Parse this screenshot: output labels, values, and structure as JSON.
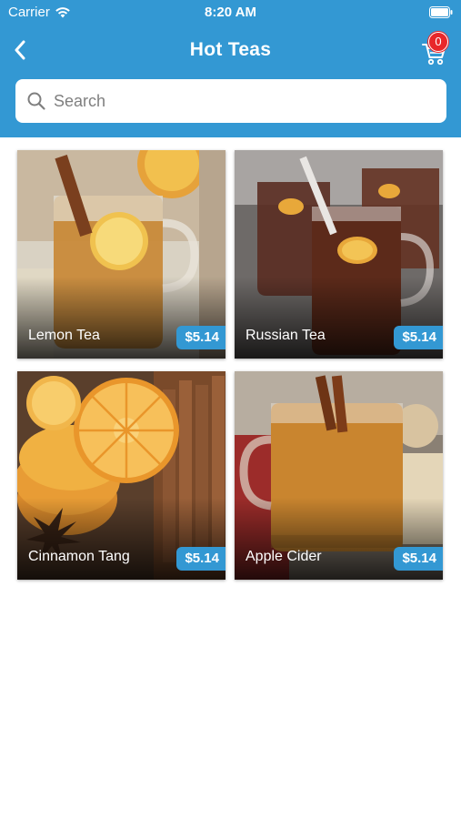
{
  "status": {
    "carrier": "Carrier",
    "time": "8:20 AM",
    "icons": [
      "wifi-icon",
      "battery-icon"
    ]
  },
  "header": {
    "title": "Hot Teas",
    "back_icon": "chevron-left-icon",
    "cart_icon": "shopping-cart-icon",
    "cart_count": "0"
  },
  "search": {
    "placeholder": "Search",
    "icon": "search-icon"
  },
  "products": [
    {
      "name": "Lemon Tea",
      "price": "$5.14"
    },
    {
      "name": "Russian Tea",
      "price": "$5.14"
    },
    {
      "name": "Cinnamon Tang",
      "price": "$5.14"
    },
    {
      "name": "Apple Cider",
      "price": "$5.14"
    }
  ],
  "colors": {
    "primary": "#3398d3",
    "badge": "#e8272a",
    "background": "#ffffff"
  }
}
